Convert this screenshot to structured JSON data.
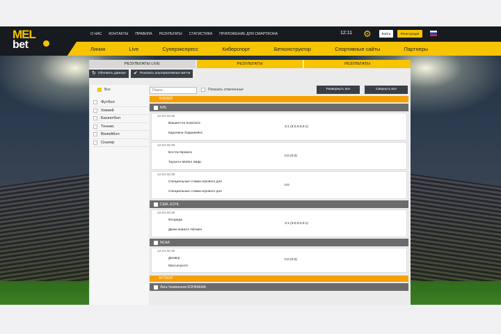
{
  "brand": {
    "line1": "MEL",
    "line2": "bet"
  },
  "topmenu": [
    "О НАС",
    "КОНТАКТЫ",
    "ПРАВИЛА",
    "РЕЗУЛЬТАТЫ",
    "СТАТИСТИКА",
    "ПРИЛОЖЕНИЕ ДЛЯ СМАРТФОНА"
  ],
  "header": {
    "time": "12:11",
    "login": "Войти",
    "register": "Регистрация"
  },
  "mainmenu": [
    "Линия",
    "Live",
    "Суперэкспресс",
    "Киберспорт",
    "Бетконструктор",
    "Спортивные сайты",
    "Партнеры"
  ],
  "tabs": [
    "РЕЗУЛЬТАТЫ LIVE",
    "РЕЗУЛЬТАТЫ",
    "РЕЗУЛЬТАТЫ"
  ],
  "toolbar": {
    "refresh": "Обновить данные",
    "show_alt": "Показать альтернативные матчи"
  },
  "filters": {
    "all": "Все",
    "search_placeholder": "Поиск...",
    "show_selected": "Показать отмеченные",
    "expand_all": "Развернуть все",
    "collapse_all": "Свернуть все"
  },
  "sports": [
    "Футбол",
    "Хоккей",
    "Баскетбол",
    "Теннис",
    "Волейбол",
    "Снукер"
  ],
  "results": {
    "hockey_label": "ХОККЕЙ",
    "football_label": "ФУТБОЛ",
    "leagues": [
      {
        "name": "NHL",
        "matches": [
          {
            "time": "12.04 02:30",
            "team1": "Вашингтон Кэпиталс",
            "team2": "Каролина Харрикейнс",
            "score": "3:1 (3:0,0:0,0:1)"
          },
          {
            "time": "12.04 02:30",
            "team1": "Бостон Брюинз",
            "team2": "Торонто Мейпл Лифс",
            "score": "0:0 (0:0)"
          },
          {
            "time": "12.04 02:30",
            "team1": "Специальные ставки игрового дня",
            "team2": "Специальные ставки игрового дня",
            "score": "0:0"
          }
        ]
      },
      {
        "name": "США. ECHL",
        "matches": [
          {
            "time": "12.04 02:30",
            "team1": "Флорида",
            "team2": "Джексонвилл Айсмен",
            "score": "3:1 (3:0,0:0,0:1)"
          }
        ]
      },
      {
        "name": "NCAA",
        "matches": [
          {
            "time": "12.04 02:30",
            "team1": "Денвер",
            "team2": "Массачусетс",
            "score": "0:0 (0:0)"
          }
        ]
      },
      {
        "name": "Лига Чемпионов КОНКАКАФ",
        "matches": []
      }
    ]
  },
  "colors": {
    "accent": "#f6c400",
    "dark": "#171a1f",
    "sport_bar": "#f6a000",
    "league_bar": "#6b6b6b"
  }
}
